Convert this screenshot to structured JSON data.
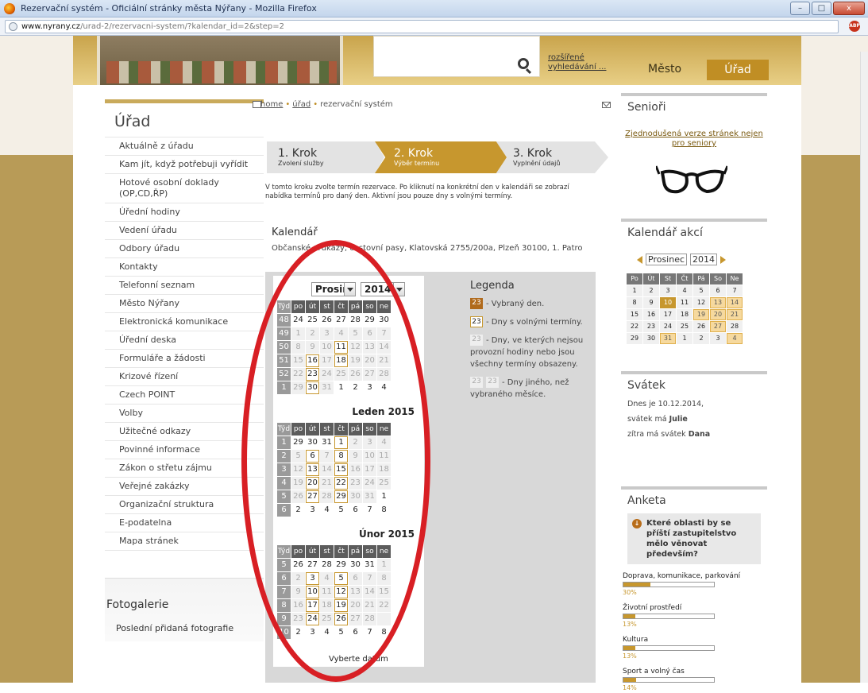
{
  "window": {
    "title": "Rezervační systém - Oficiální stránky města Nýřany - Mozilla Firefox",
    "btn_min": "–",
    "btn_max": "□",
    "btn_close": "x"
  },
  "address": {
    "domain": "www.nyrany.cz",
    "path": "/urad-2/rezervacni-system/?kalendar_id=2&step=2",
    "abp": "ABP"
  },
  "header": {
    "adv_search": "rozšířené vyhledávání ...",
    "tab_mesto": "Město",
    "tab_urad": "Úřad"
  },
  "leftnav": {
    "title": "Úřad",
    "items": [
      "Aktuálně z úřadu",
      "Kam jít, když potřebuji vyřídit",
      "Hotové osobní doklady (OP,CD,ŘP)",
      "Úřední hodiny",
      "Vedení úřadu",
      "Odbory úřadu",
      "Kontakty",
      "Telefonní seznam",
      "Město Nýřany",
      "Elektronická komunikace",
      "Úřední deska",
      "Formuláře a žádosti",
      "Krizové řízení",
      "Czech POINT",
      "Volby",
      "Užitečné odkazy",
      "Povinné informace",
      "Zákon o střetu zájmu",
      "Veřejné zakázky",
      "Organizační struktura",
      "E-podatelna",
      "Mapa stránek"
    ]
  },
  "fotogalerie": {
    "title": "Fotogalerie",
    "link": "Poslední přidaná fotografie"
  },
  "breadcrumb": {
    "home": "home",
    "urad": "úřad",
    "current": "rezervační systém",
    "sep": "•"
  },
  "steps": [
    {
      "title": "1. Krok",
      "sub": "Zvolení služby"
    },
    {
      "title": "2. Krok",
      "sub": "Výběr termínu"
    },
    {
      "title": "3. Krok",
      "sub": "Vyplnění údajů"
    }
  ],
  "intro": "V tomto kroku zvolte termín rezervace. Po kliknutí na konkrétní den v kalendáři se zobrazí nabídka termínů pro daný den. Aktivní jsou pouze dny s volnými termíny.",
  "kalendar": {
    "title": "Kalendář",
    "subtitle": "Občanské průkazy, cestovní pasy, Klatovská 2755/200a, Plzeň 30100, 1. Patro",
    "month_select": "Prosin",
    "year_select": "2014",
    "pick": "Vyberte datum",
    "headers": [
      "Týd",
      "po",
      "út",
      "st",
      "čt",
      "pá",
      "so",
      "ne"
    ],
    "months": [
      {
        "label": "",
        "rows": [
          [
            "48",
            "24",
            "25",
            "26",
            "27",
            "28",
            "29",
            "30"
          ],
          [
            "49",
            "1",
            "2",
            "3",
            "4",
            "5",
            "6",
            "7"
          ],
          [
            "50",
            "8",
            "9",
            "10",
            "11",
            "12",
            "13",
            "14"
          ],
          [
            "51",
            "15",
            "16",
            "17",
            "18",
            "19",
            "20",
            "21"
          ],
          [
            "52",
            "22",
            "23",
            "24",
            "25",
            "26",
            "27",
            "28"
          ],
          [
            "1",
            "29",
            "30",
            "31",
            "1",
            "2",
            "3",
            "4"
          ]
        ]
      },
      {
        "label": "Leden 2015",
        "rows": [
          [
            "1",
            "29",
            "30",
            "31",
            "1",
            "2",
            "3",
            "4"
          ],
          [
            "2",
            "5",
            "6",
            "7",
            "8",
            "9",
            "10",
            "11"
          ],
          [
            "3",
            "12",
            "13",
            "14",
            "15",
            "16",
            "17",
            "18"
          ],
          [
            "4",
            "19",
            "20",
            "21",
            "22",
            "23",
            "24",
            "25"
          ],
          [
            "5",
            "26",
            "27",
            "28",
            "29",
            "30",
            "31",
            "1"
          ],
          [
            "6",
            "2",
            "3",
            "4",
            "5",
            "6",
            "7",
            "8"
          ]
        ]
      },
      {
        "label": "Únor 2015",
        "rows": [
          [
            "5",
            "26",
            "27",
            "28",
            "29",
            "30",
            "31",
            "1"
          ],
          [
            "6",
            "2",
            "3",
            "4",
            "5",
            "6",
            "7",
            "8"
          ],
          [
            "7",
            "9",
            "10",
            "11",
            "12",
            "13",
            "14",
            "15"
          ],
          [
            "8",
            "16",
            "17",
            "18",
            "19",
            "20",
            "21",
            "22"
          ],
          [
            "9",
            "23",
            "24",
            "25",
            "26",
            "27",
            "28",
            ""
          ],
          [
            "10",
            "2",
            "3",
            "4",
            "5",
            "6",
            "7",
            "8"
          ]
        ]
      }
    ]
  },
  "legend": {
    "title": "Legenda",
    "r1": "- Vybraný den.",
    "r2": "- Dny s volnými termíny.",
    "r3": "- Dny, ve kterých nejsou provozní hodiny nebo jsou všechny termíny obsazeny.",
    "r4": "- Dny jiného, než vybraného měsíce.",
    "n": "23"
  },
  "senior": {
    "title": "Senioři",
    "link": "Zjednodušená verze stránek nejen pro seniory"
  },
  "akce": {
    "title": "Kalendář akcí",
    "month": "Prosinec",
    "year": "2014",
    "headers": [
      "Po",
      "Út",
      "St",
      "Čt",
      "Pá",
      "So",
      "Ne"
    ],
    "rows": [
      [
        "1",
        "2",
        "3",
        "4",
        "5",
        "6",
        "7"
      ],
      [
        "8",
        "9",
        "10",
        "11",
        "12",
        "13",
        "14"
      ],
      [
        "15",
        "16",
        "17",
        "18",
        "19",
        "20",
        "21"
      ],
      [
        "22",
        "23",
        "24",
        "25",
        "26",
        "27",
        "28"
      ],
      [
        "29",
        "30",
        "31",
        "1",
        "2",
        "3",
        "4"
      ]
    ]
  },
  "svatek": {
    "title": "Svátek",
    "l1": "Dnes je 10.12.2014,",
    "l2a": "svátek má ",
    "l2b": "Julie",
    "l3a": "zítra má svátek ",
    "l3b": "Dana"
  },
  "anketa": {
    "title": "Anketa",
    "question": "Které oblasti by se příští zastupitelstvo mělo věnovat především?",
    "options": [
      {
        "label": "Doprava, komunikace, parkování",
        "pct": "30%",
        "val": 30
      },
      {
        "label": "Životní prostředí",
        "pct": "13%",
        "val": 13
      },
      {
        "label": "Kultura",
        "pct": "13%",
        "val": 13
      },
      {
        "label": "Sport a volný čas",
        "pct": "14%",
        "val": 14
      }
    ]
  }
}
